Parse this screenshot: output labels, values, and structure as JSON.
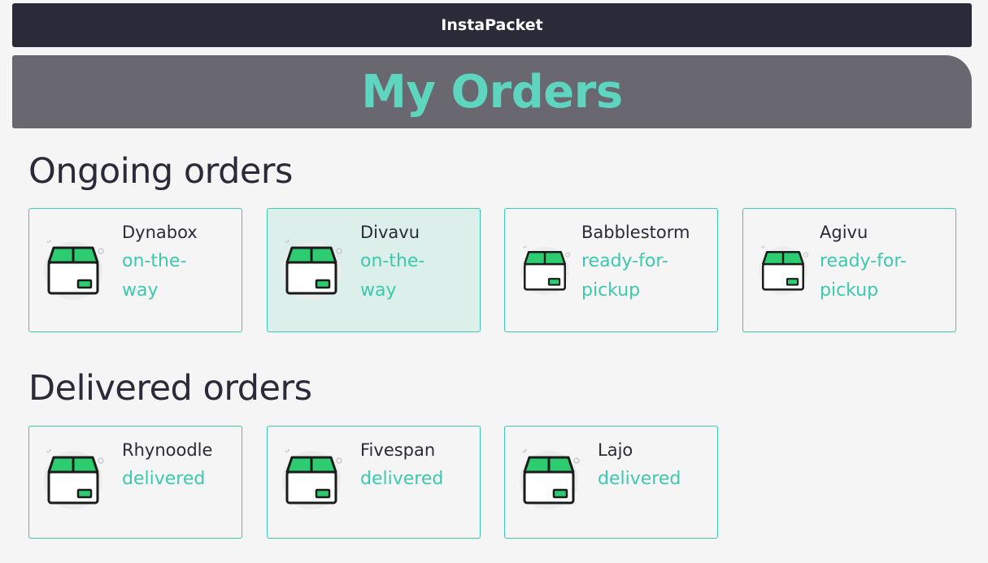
{
  "app": {
    "brand": "InstaPacket"
  },
  "page": {
    "title": "My Orders"
  },
  "ongoing": {
    "title": "Ongoing orders",
    "orders": [
      {
        "name": "Dynabox",
        "status_line1": "on-the-",
        "status_line2": "way"
      },
      {
        "name": "Divavu",
        "status_line1": "on-the-",
        "status_line2": "way"
      },
      {
        "name": "Babblestorm",
        "status_line1": "ready-for-",
        "status_line2": "pickup"
      },
      {
        "name": "Agivu",
        "status_line1": "ready-for-",
        "status_line2": "pickup"
      }
    ]
  },
  "delivered": {
    "title": "Delivered orders",
    "orders": [
      {
        "name": "Rhynoodle",
        "status": "delivered"
      },
      {
        "name": "Fivespan",
        "status": "delivered"
      },
      {
        "name": "Lajo",
        "status": "delivered"
      }
    ]
  },
  "colors": {
    "nav_bg": "#2b2a38",
    "banner_bg": "#696871",
    "accent": "#5ed5bf",
    "status_text": "#3cc9ad",
    "package_lid": "#2ecc71"
  },
  "icons": {
    "order": "package-box-icon"
  }
}
